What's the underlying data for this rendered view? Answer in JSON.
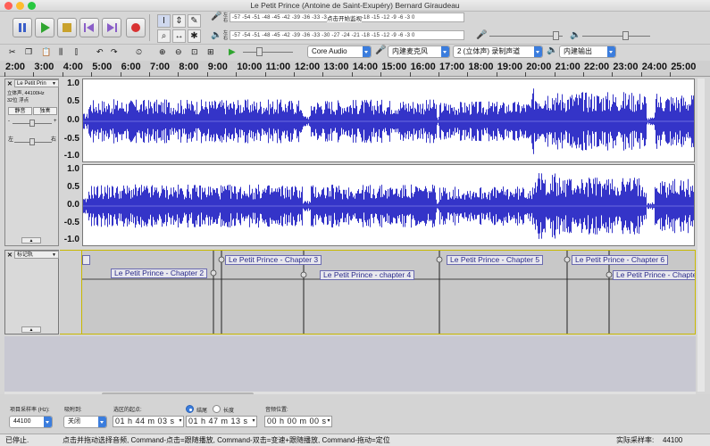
{
  "window": {
    "title": "Le Petit Prince (Antoine de Saint-Exupéry) Bernard Giraudeau",
    "colors": {
      "close": "#ff5f57",
      "minimize": "#febc2e",
      "zoom": "#28c840",
      "accent": "#3b7ddd",
      "waveform": "#3434c8"
    }
  },
  "meters": {
    "record_hint": "点击开始监视",
    "rec_ticks": [
      "-57",
      "-54",
      "-51",
      "-48",
      "-45",
      "-42",
      "-39",
      "-36",
      "-33",
      "-30",
      "-27",
      "-24",
      "-21",
      "-18",
      "-15",
      "-12",
      "-9",
      "-6",
      "-3",
      "0"
    ],
    "play_ticks": [
      "-57",
      "-54",
      "-51",
      "-48",
      "-45",
      "-42",
      "-39",
      "-36",
      "-33",
      "-30",
      "-27",
      "-24",
      "-21",
      "-18",
      "-15",
      "-12",
      "-9",
      "-6",
      "-3",
      "0"
    ],
    "left": "左",
    "right": "右"
  },
  "device": {
    "host": "Core Audio",
    "input": "内建麦克风",
    "channels": "2 (立体声) 录制声道",
    "output": "内建输出"
  },
  "ruler": {
    "ticks": [
      "2:00",
      "3:00",
      "4:00",
      "5:00",
      "6:00",
      "7:00",
      "8:00",
      "9:00",
      "10:00",
      "11:00",
      "12:00",
      "13:00",
      "14:00",
      "15:00",
      "16:00",
      "17:00",
      "18:00",
      "19:00",
      "20:00",
      "21:00",
      "22:00",
      "23:00",
      "24:00",
      "25:00"
    ]
  },
  "audio_track": {
    "name": "Le Petit Prin",
    "info1": "立体声, 44100Hz",
    "info2": "32位 浮点",
    "mute": "静音",
    "solo": "独奏",
    "pan_left": "左",
    "pan_right": "右",
    "y_labels_top": [
      "1.0",
      "0.5",
      "0.0",
      "-0.5",
      "-1.0"
    ],
    "y_labels_bottom": [
      "1.0",
      "0.5",
      "0.0",
      "-0.5",
      "-1.0"
    ]
  },
  "label_track": {
    "name": "标记轨",
    "labels": [
      {
        "text": "Le Petit Prince - Chapter 2"
      },
      {
        "text": "Le Petit Prince - Chapter 3"
      },
      {
        "text": "Le Petit Prince - chapter 4"
      },
      {
        "text": "Le Petit Prince - Chapter 5"
      },
      {
        "text": "Le Petit Prince - Chapter 6"
      },
      {
        "text": "Le Petit Prince - Chapte"
      }
    ]
  },
  "selection_bar": {
    "rate_label": "项目采样率 (Hz):",
    "rate_value": "44100",
    "snap_label": "吸附到:",
    "snap_value": "关闭",
    "start_label": "选区的起点:",
    "end_radio": "结尾",
    "length_radio": "长度",
    "audio_pos_label": "音频位置:",
    "start_value": "01 h 44 m 03 s",
    "end_value": "01 h 47 m 13 s",
    "pos_value": "00 h 00 m 00 s"
  },
  "status": {
    "state": "已停止.",
    "hint": "点击并拖动选择音频, Command-点击=跟随播放, Command-双击=变速+跟随播放, Command-拖动=定位",
    "rate_label": "实际采样率:",
    "rate_value": "44100"
  }
}
